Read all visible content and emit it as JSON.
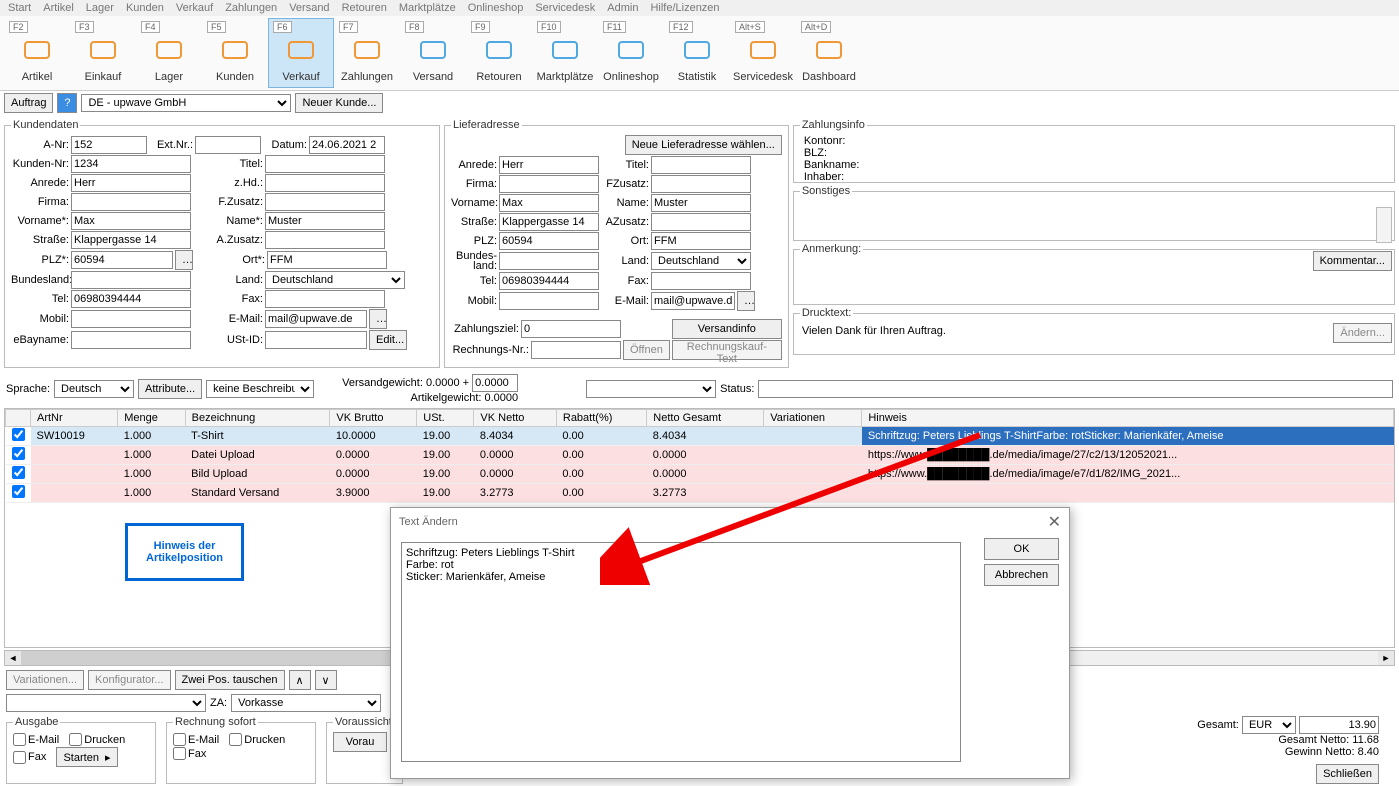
{
  "menu": [
    "Start",
    "Artikel",
    "Lager",
    "Kunden",
    "Verkauf",
    "Zahlungen",
    "Versand",
    "Retouren",
    "Marktplätze",
    "Onlineshop",
    "Servicedesk",
    "Admin",
    "Hilfe/Lizenzen"
  ],
  "toolbar": [
    {
      "fkey": "F2",
      "label": "Artikel"
    },
    {
      "fkey": "F3",
      "label": "Einkauf"
    },
    {
      "fkey": "F4",
      "label": "Lager"
    },
    {
      "fkey": "F5",
      "label": "Kunden"
    },
    {
      "fkey": "F6",
      "label": "Verkauf"
    },
    {
      "fkey": "F7",
      "label": "Zahlungen"
    },
    {
      "fkey": "F8",
      "label": "Versand"
    },
    {
      "fkey": "F9",
      "label": "Retouren"
    },
    {
      "fkey": "F10",
      "label": "Marktplätze"
    },
    {
      "fkey": "F11",
      "label": "Onlineshop"
    },
    {
      "fkey": "F12",
      "label": "Statistik"
    },
    {
      "fkey": "Alt+S",
      "label": "Servicedesk"
    },
    {
      "fkey": "Alt+D",
      "label": "Dashboard"
    }
  ],
  "topbar": {
    "auftrag": "Auftrag",
    "company": "DE - upwave GmbH",
    "neuerKunde": "Neuer Kunde..."
  },
  "kundendaten": {
    "legend": "Kundendaten",
    "labels": {
      "anr": "A-Nr:",
      "ext": "Ext.Nr.:",
      "datum": "Datum:",
      "kundennr": "Kunden-Nr:",
      "titel": "Titel:",
      "anrede": "Anrede:",
      "zhd": "z.Hd.:",
      "firma": "Firma:",
      "fzusatz": "F.Zusatz:",
      "vorname": "Vorname*:",
      "name": "Name*:",
      "strasse": "Straße:",
      "azusatz": "A.Zusatz:",
      "plz": "PLZ*:",
      "ort": "Ort*:",
      "bundesland": "Bundesland:",
      "land": "Land:",
      "tel": "Tel:",
      "fax": "Fax:",
      "mobil": "Mobil:",
      "email": "E-Mail:",
      "ebay": "eBayname:",
      "ustid": "USt-ID:",
      "edit": "Edit..."
    },
    "values": {
      "anr": "152",
      "ext": "",
      "datum": "24.06.2021 2",
      "kundennr": "1234",
      "titel": "",
      "anrede": "Herr",
      "zhd": "",
      "firma": "",
      "fzusatz": "",
      "vorname": "Max",
      "name": "Muster",
      "strasse": "Klappergasse 14",
      "azusatz": "",
      "plz": "60594",
      "ort": "FFM",
      "bundesland": "",
      "land": "Deutschland",
      "tel": "06980394444",
      "fax": "",
      "mobil": "",
      "email": "mail@upwave.de",
      "ebay": "",
      "ustid": ""
    }
  },
  "lieferadresse": {
    "legend": "Lieferadresse",
    "btn": "Neue Lieferadresse wählen...",
    "labels": {
      "anrede": "Anrede:",
      "titel": "Titel:",
      "firma": "Firma:",
      "fzusatz": "FZusatz:",
      "vorname": "Vorname:",
      "name": "Name:",
      "strasse": "Straße:",
      "azusatz": "AZusatz:",
      "plz": "PLZ:",
      "ort": "Ort:",
      "bundesland": "Bundes-\nland:",
      "land": "Land:",
      "tel": "Tel:",
      "fax": "Fax:",
      "mobil": "Mobil:",
      "email": "E-Mail:"
    },
    "values": {
      "anrede": "Herr",
      "titel": "",
      "firma": "",
      "fzusatz": "",
      "vorname": "Max",
      "name": "Muster",
      "strasse": "Klappergasse 14",
      "azusatz": "",
      "plz": "60594",
      "ort": "FFM",
      "bundesland": "",
      "land": "Deutschland",
      "tel": "06980394444",
      "fax": "",
      "mobil": "",
      "email": "mail@upwave.de"
    },
    "zahlungsziel": {
      "label": "Zahlungsziel:",
      "value": "0"
    },
    "rechnungsnr": {
      "label": "Rechnungs-Nr.:",
      "value": "",
      "oeffnen": "Öffnen"
    },
    "versandinfo": "Versandinfo",
    "rechnungskauf": "Rechnungskauf-Text"
  },
  "zahlungsinfo": {
    "legend": "Zahlungsinfo",
    "kontonr": "Kontonr:",
    "blz": "BLZ:",
    "bankname": "Bankname:",
    "inhaber": "Inhaber:"
  },
  "sonstiges": {
    "legend": "Sonstiges"
  },
  "anmerkung": {
    "legend": "Anmerkung:",
    "kommentar": "Kommentar..."
  },
  "drucktext": {
    "legend": "Drucktext:",
    "value": "Vielen Dank für Ihren Auftrag.",
    "aendern": "Ändern..."
  },
  "optrow": {
    "sprache": "Sprache:",
    "sprache_val": "Deutsch",
    "attribute": "Attribute...",
    "beschr": "keine Beschreibun",
    "versandgewicht": "Versandgewicht:",
    "artikelgewicht": "Artikelgewicht:",
    "vg": "0.0000",
    "ag": "0.0000",
    "status": "Status:"
  },
  "table": {
    "cols": [
      "",
      "ArtNr",
      "Menge",
      "Bezeichnung",
      "VK Brutto",
      "USt.",
      "VK Netto",
      "Rabatt(%)",
      "Netto Gesamt",
      "Variationen",
      "Hinweis"
    ],
    "rows": [
      {
        "chk": true,
        "art": "SW10019",
        "menge": "1.000",
        "bez": "T-Shirt",
        "brutto": "10.0000",
        "ust": "19.00",
        "netto": "8.4034",
        "rabatt": "0.00",
        "ng": "8.4034",
        "var": "",
        "hinweis": "Schriftzug: Peters Lieblings T-ShirtFarbe: rotSticker: Marienkäfer, Ameise"
      },
      {
        "chk": true,
        "art": "",
        "menge": "1.000",
        "bez": "Datei Upload",
        "brutto": "0.0000",
        "ust": "19.00",
        "netto": "0.0000",
        "rabatt": "0.00",
        "ng": "0.0000",
        "var": "",
        "hinweis": "https://www.████████.de/media/image/27/c2/13/12052021..."
      },
      {
        "chk": true,
        "art": "",
        "menge": "1.000",
        "bez": "Bild Upload",
        "brutto": "0.0000",
        "ust": "19.00",
        "netto": "0.0000",
        "rabatt": "0.00",
        "ng": "0.0000",
        "var": "",
        "hinweis": "https://www.████████.de/media/image/e7/d1/82/IMG_2021..."
      },
      {
        "chk": true,
        "art": "",
        "menge": "1.000",
        "bez": "Standard Versand",
        "brutto": "3.9000",
        "ust": "19.00",
        "netto": "3.2773",
        "rabatt": "0.00",
        "ng": "3.2773",
        "var": "",
        "hinweis": ""
      }
    ]
  },
  "callout": {
    "line1": "Hinweis der",
    "line2": "Artikelposition"
  },
  "dialog": {
    "title": "Text Ändern",
    "text": "Schriftzug: Peters Lieblings T-Shirt\nFarbe: rot\nSticker: Marienkäfer, Ameise",
    "ok": "OK",
    "abbrechen": "Abbrechen"
  },
  "underTable": {
    "variationen": "Variationen...",
    "konfig": "Konfigurator...",
    "tauschen": "Zwei Pos. tauschen",
    "za": "ZA:",
    "za_val": "Vorkasse"
  },
  "ausgabe": {
    "legend": "Ausgabe",
    "email": "E-Mail",
    "drucken": "Drucken",
    "fax": "Fax",
    "starten": "Starten"
  },
  "rechnung": {
    "legend": "Rechnung sofort",
    "email": "E-Mail",
    "drucken": "Drucken",
    "fax": "Fax"
  },
  "voraus": {
    "legend": "Voraussichtl",
    "btn": "Vorau"
  },
  "totals": {
    "gesamt": "Gesamt:",
    "cur": "EUR",
    "val": "13.90",
    "gn": "Gesamt Netto: 11.68",
    "gwn": "Gewinn Netto: 8.40",
    "schliessen": "Schließen"
  }
}
